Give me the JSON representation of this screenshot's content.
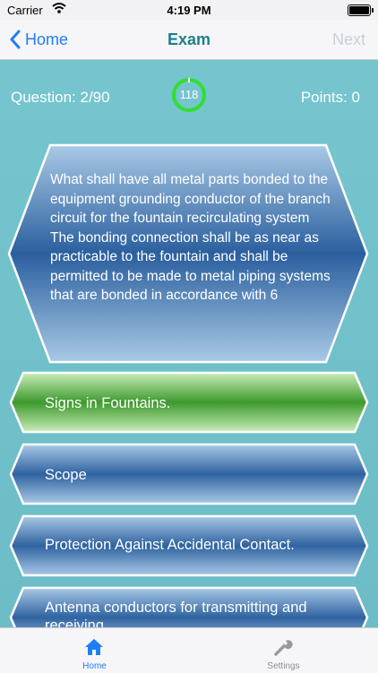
{
  "status_bar": {
    "carrier": "Carrier",
    "time": "4:19 PM"
  },
  "nav": {
    "back_label": "Home",
    "title": "Exam",
    "next_label": "Next"
  },
  "stats": {
    "question": "Question: 2/90",
    "timer": "118",
    "points": "Points: 0"
  },
  "question": {
    "text": "What shall have all metal parts bonded to the equipment grounding conductor of the branch circuit for the fountain recirculating system The bonding connection shall be as near as practicable to the fountain and shall be permitted to be made to metal piping systems that are bonded in accordance with 6"
  },
  "answers": [
    {
      "label": "Signs in Fountains.",
      "state": "correct"
    },
    {
      "label": "Scope",
      "state": "default"
    },
    {
      "label": "Protection Against Accidental Contact.",
      "state": "default"
    },
    {
      "label": "Antenna conductors for transmitting and receiving.",
      "state": "default"
    }
  ],
  "tabs": [
    {
      "label": "Home",
      "icon": "home-icon",
      "active": true
    },
    {
      "label": "Settings",
      "icon": "wrench-icon",
      "active": false
    }
  ],
  "colors": {
    "background": "#6bbcc6",
    "nav_title": "#1d7f8a",
    "link_blue": "#1f7ef6",
    "timer_green": "#2fe02f",
    "correct_green": "#3e9a2e",
    "hex_blue": "#2f63a0"
  }
}
